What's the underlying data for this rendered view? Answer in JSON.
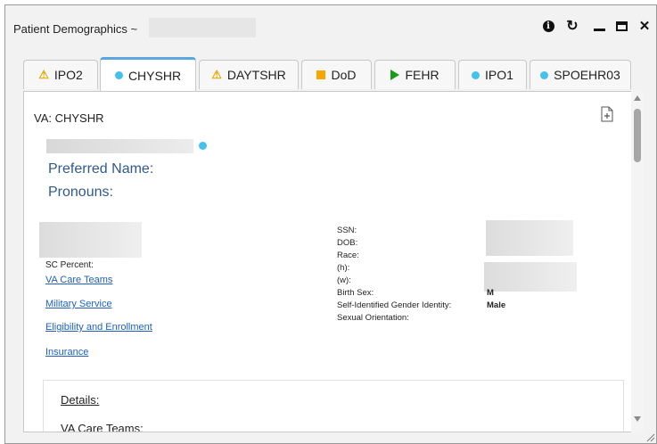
{
  "window": {
    "title": "Patient Demographics ~",
    "controls": [
      "info-icon",
      "refresh-icon",
      "minimize-icon",
      "maximize-icon",
      "close-icon"
    ]
  },
  "tabs": [
    {
      "label": "IPO2",
      "icon": "warning-icon"
    },
    {
      "label": "CHYSHR",
      "icon": "dot-icon",
      "active": true
    },
    {
      "label": "DAYTSHR",
      "icon": "warning-icon"
    },
    {
      "label": "DoD",
      "icon": "square-icon"
    },
    {
      "label": "FEHR",
      "icon": "play-icon"
    },
    {
      "label": "IPO1",
      "icon": "dot-icon"
    },
    {
      "label": "SPOEHR03",
      "icon": "dot-icon"
    }
  ],
  "panel": {
    "title": "VA: CHYSHR",
    "preferred_name_label": "Preferred Name:",
    "pronouns_label": "Pronouns:",
    "sc_percent_label": "SC Percent:",
    "links": [
      "VA Care Teams",
      "Military Service",
      "Eligibility and Enrollment",
      "Insurance"
    ],
    "fields": [
      {
        "label": "SSN:",
        "value": ""
      },
      {
        "label": "DOB:",
        "value": ""
      },
      {
        "label": "Race:",
        "value": ""
      },
      {
        "label": "(h):",
        "value": ""
      },
      {
        "label": "(w):",
        "value": ""
      },
      {
        "label": "Birth Sex:",
        "value": "M"
      },
      {
        "label": "Self-Identified Gender Identity:",
        "value": "Male"
      },
      {
        "label": "Sexual Orientation:",
        "value": ""
      }
    ],
    "details_title": "Details:",
    "details_sub": "VA Care Teams:"
  },
  "colors": {
    "accent": "#5aa6e0",
    "link": "#1f5fbf",
    "label_blue": "#2e5a8c",
    "status_dot": "#45c1ee",
    "warning": "#e6a800",
    "dod_square": "#f5a800",
    "fehr_play": "#1a9c1a"
  }
}
